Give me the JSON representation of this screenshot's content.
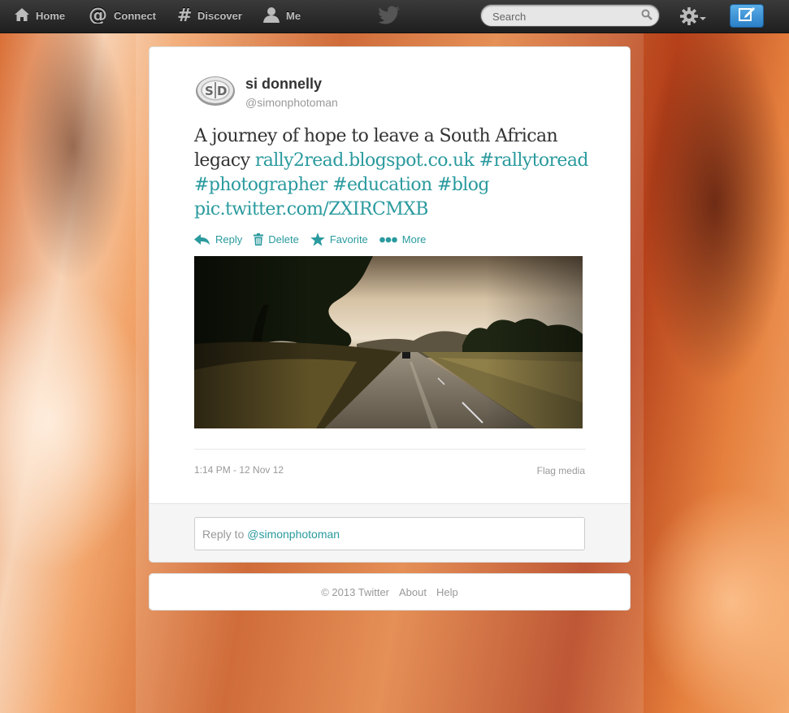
{
  "nav": {
    "home": "Home",
    "connect": "Connect",
    "discover": "Discover",
    "me": "Me"
  },
  "search": {
    "placeholder": "Search"
  },
  "tweet": {
    "fullname": "si donnelly",
    "username": "@simonphotoman",
    "text_plain": "A journey of hope to leave a South African legacy",
    "link": "rally2read.blogspot.co.uk",
    "hashtags": [
      "#rallytoread",
      "#photographer",
      "#education",
      "#blog"
    ],
    "pic_link": "pic.twitter.com/ZXIRCMXB",
    "actions": {
      "reply": "Reply",
      "delete": "Delete",
      "favorite": "Favorite",
      "more": "More"
    },
    "timestamp": "1:14 PM - 12 Nov 12",
    "flag": "Flag media"
  },
  "reply": {
    "prefix": "Reply to",
    "mention": "@simonphotoman"
  },
  "footer": {
    "copyright": "© 2013 Twitter",
    "about": "About",
    "help": "Help"
  },
  "colors": {
    "link": "#2a9a9e",
    "topbar": "#2b2b2b",
    "compose": "#3d94da"
  }
}
